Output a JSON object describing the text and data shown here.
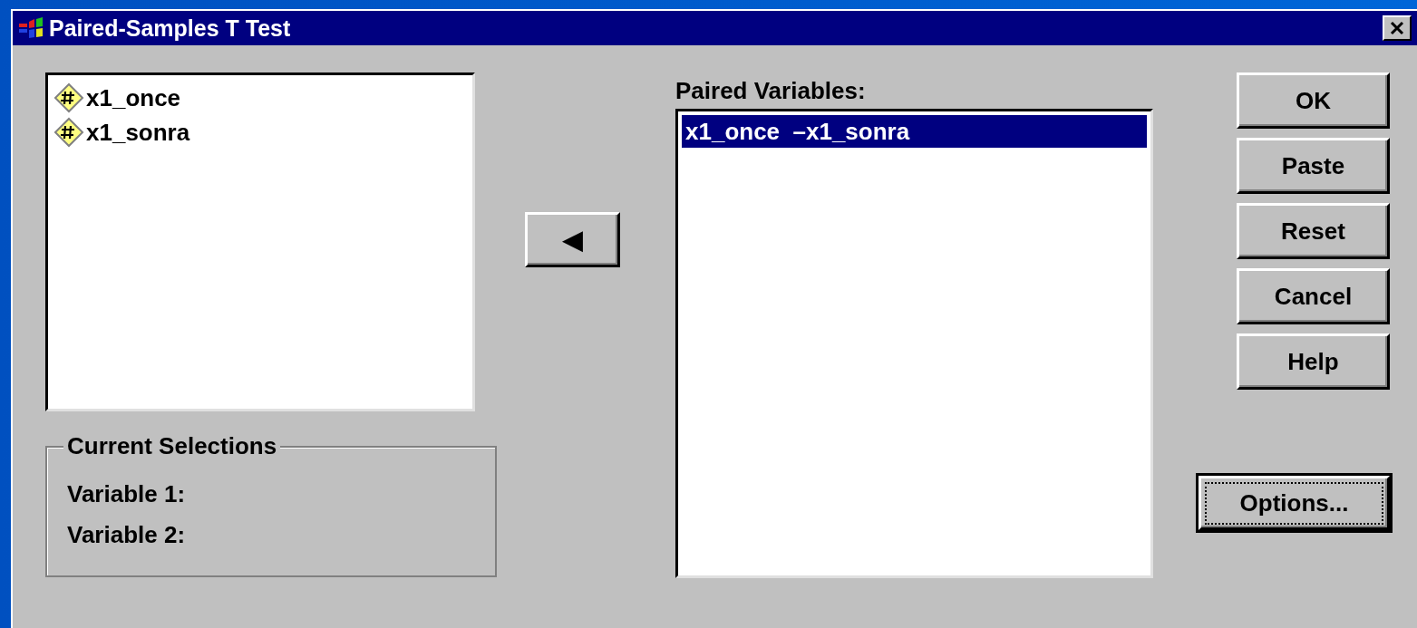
{
  "window": {
    "title": "Paired-Samples T Test"
  },
  "source_list": {
    "items": [
      {
        "label": "x1_once",
        "selected": false
      },
      {
        "label": "x1_sonra",
        "selected": false
      }
    ]
  },
  "current_selections": {
    "title": "Current Selections",
    "fields": [
      {
        "label": "Variable 1:"
      },
      {
        "label": "Variable 2:"
      }
    ]
  },
  "move_button": {
    "symbol": "◀"
  },
  "paired_variables": {
    "label": "Paired Variables:",
    "items": [
      {
        "first": "x1_once",
        "separator": "–",
        "second": "x1_sonra",
        "selected": true
      }
    ]
  },
  "buttons": [
    {
      "label": "OK",
      "default": false
    },
    {
      "label": "Paste",
      "default": false
    },
    {
      "label": "Reset",
      "default": false
    },
    {
      "label": "Cancel",
      "default": false
    },
    {
      "label": "Help",
      "default": false
    }
  ],
  "options_button": {
    "label": "Options...",
    "default": true
  }
}
